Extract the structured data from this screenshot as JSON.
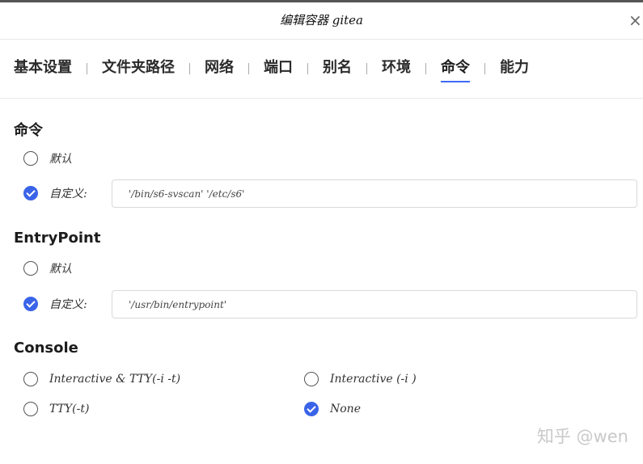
{
  "dialog": {
    "title": "编辑容器 gitea",
    "close_label": "×"
  },
  "tabs": [
    {
      "label": "基本设置",
      "active": false
    },
    {
      "label": "文件夹路径",
      "active": false
    },
    {
      "label": "网络",
      "active": false
    },
    {
      "label": "端口",
      "active": false
    },
    {
      "label": "别名",
      "active": false
    },
    {
      "label": "环境",
      "active": false
    },
    {
      "label": "命令",
      "active": true
    },
    {
      "label": "能力",
      "active": false
    }
  ],
  "command": {
    "title": "命令",
    "default_label": "默认",
    "custom_label": "自定义:",
    "selected": "custom",
    "value": "'/bin/s6-svscan' '/etc/s6'"
  },
  "entrypoint": {
    "title": "EntryPoint",
    "default_label": "默认",
    "custom_label": "自定义:",
    "selected": "custom",
    "value": "'/usr/bin/entrypoint'"
  },
  "console": {
    "title": "Console",
    "options": [
      {
        "label": "Interactive & TTY(-i -t)",
        "checked": false
      },
      {
        "label": "Interactive (-i )",
        "checked": false
      },
      {
        "label": "TTY(-t)",
        "checked": false
      },
      {
        "label": "None",
        "checked": true
      }
    ]
  },
  "watermark": "知乎 @wen",
  "colors": {
    "accent": "#3a64e8",
    "tab_underline": "#3d6af5"
  }
}
